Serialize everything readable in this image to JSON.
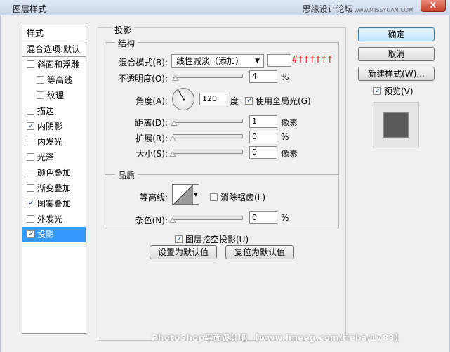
{
  "window": {
    "title": "图层样式",
    "watermark": "思缘设计论坛",
    "watermark_url": "www.MISSYUAN.COM",
    "close": "X"
  },
  "style_list": {
    "header": "样式",
    "blend_options": "混合选项:默认",
    "items": [
      {
        "label": "斜面和浮雕",
        "checked": false,
        "indent": false
      },
      {
        "label": "等高线",
        "checked": false,
        "indent": true
      },
      {
        "label": "纹理",
        "checked": false,
        "indent": true
      },
      {
        "label": "描边",
        "checked": false,
        "indent": false
      },
      {
        "label": "内阴影",
        "checked": true,
        "indent": false
      },
      {
        "label": "内发光",
        "checked": false,
        "indent": false
      },
      {
        "label": "光泽",
        "checked": false,
        "indent": false
      },
      {
        "label": "颜色叠加",
        "checked": false,
        "indent": false
      },
      {
        "label": "渐变叠加",
        "checked": false,
        "indent": false
      },
      {
        "label": "图案叠加",
        "checked": true,
        "indent": false
      },
      {
        "label": "外发光",
        "checked": false,
        "indent": false
      },
      {
        "label": "投影",
        "checked": true,
        "indent": false,
        "selected": true
      }
    ]
  },
  "panel": {
    "title": "投影",
    "structure": {
      "title": "结构",
      "blend_mode_label": "混合模式(B):",
      "blend_mode_value": "线性减淡（添加）",
      "color_hex": "#ffffff",
      "opacity_label": "不透明度(O):",
      "opacity_value": "4",
      "opacity_unit": "%",
      "opacity_fraction": 0.04,
      "angle_label": "角度(A):",
      "angle_value": "120",
      "angle_unit": "度",
      "global_light_label": "使用全局光(G)",
      "global_light_checked": true,
      "distance_label": "距离(D):",
      "distance_value": "1",
      "distance_unit": "像素",
      "spread_label": "扩展(R):",
      "spread_value": "0",
      "spread_unit": "%",
      "size_label": "大小(S):",
      "size_value": "0",
      "size_unit": "像素"
    },
    "quality": {
      "title": "品质",
      "contour_label": "等高线:",
      "anti_alias_label": "消除锯齿(L)",
      "anti_alias_checked": false,
      "noise_label": "杂色(N):",
      "noise_value": "0",
      "noise_unit": "%"
    },
    "knockout_label": "图层挖空投影(U)",
    "knockout_checked": true,
    "make_default": "设置为默认值",
    "reset_default": "复位为默认值"
  },
  "buttons": {
    "ok": "确定",
    "cancel": "取消",
    "new_style": "新建样式(W)...",
    "preview_label": "预览(V)",
    "preview_checked": true
  },
  "footer_watermark": "PhotoShop平面设计吧 【www.lineeg.com/tieba/1783】"
}
